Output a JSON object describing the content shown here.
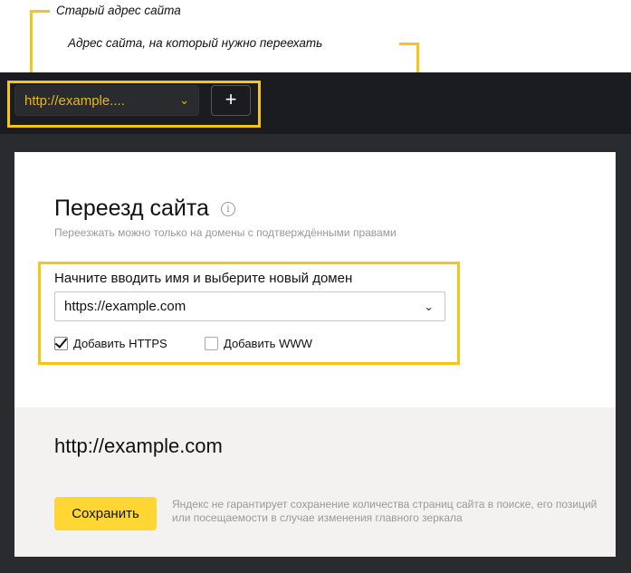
{
  "annotations": {
    "old_address": "Старый адрес сайта",
    "new_address": "Адрес сайта, на который нужно переехать"
  },
  "header": {
    "site_selector_value": "http://example....",
    "add_button_label": "+"
  },
  "move": {
    "title": "Переезд сайта",
    "subtitle": "Переезжать можно только на домены с подтверждёнными правами",
    "domain_label": "Начните вводить имя и выберите новый домен",
    "domain_value": "https://example.com",
    "add_https_label": "Добавить HTTPS",
    "add_https_checked": true,
    "add_www_label": "Добавить WWW",
    "add_www_checked": false
  },
  "result": {
    "new_url": "http://example.com",
    "save_label": "Сохранить",
    "disclaimer": "Яндекс не гарантирует сохранение количества страниц сайта в поиске, его позиций или посещаемости в случае изменения главного зеркала"
  },
  "colors": {
    "accent_yellow": "#f5c518",
    "header_dark": "#1b1c1f",
    "save_button": "#ffd633"
  },
  "icons": {
    "info": "info-icon",
    "dropdown": "chevron-down-icon",
    "add": "plus-icon",
    "check": "checkmark-icon"
  }
}
